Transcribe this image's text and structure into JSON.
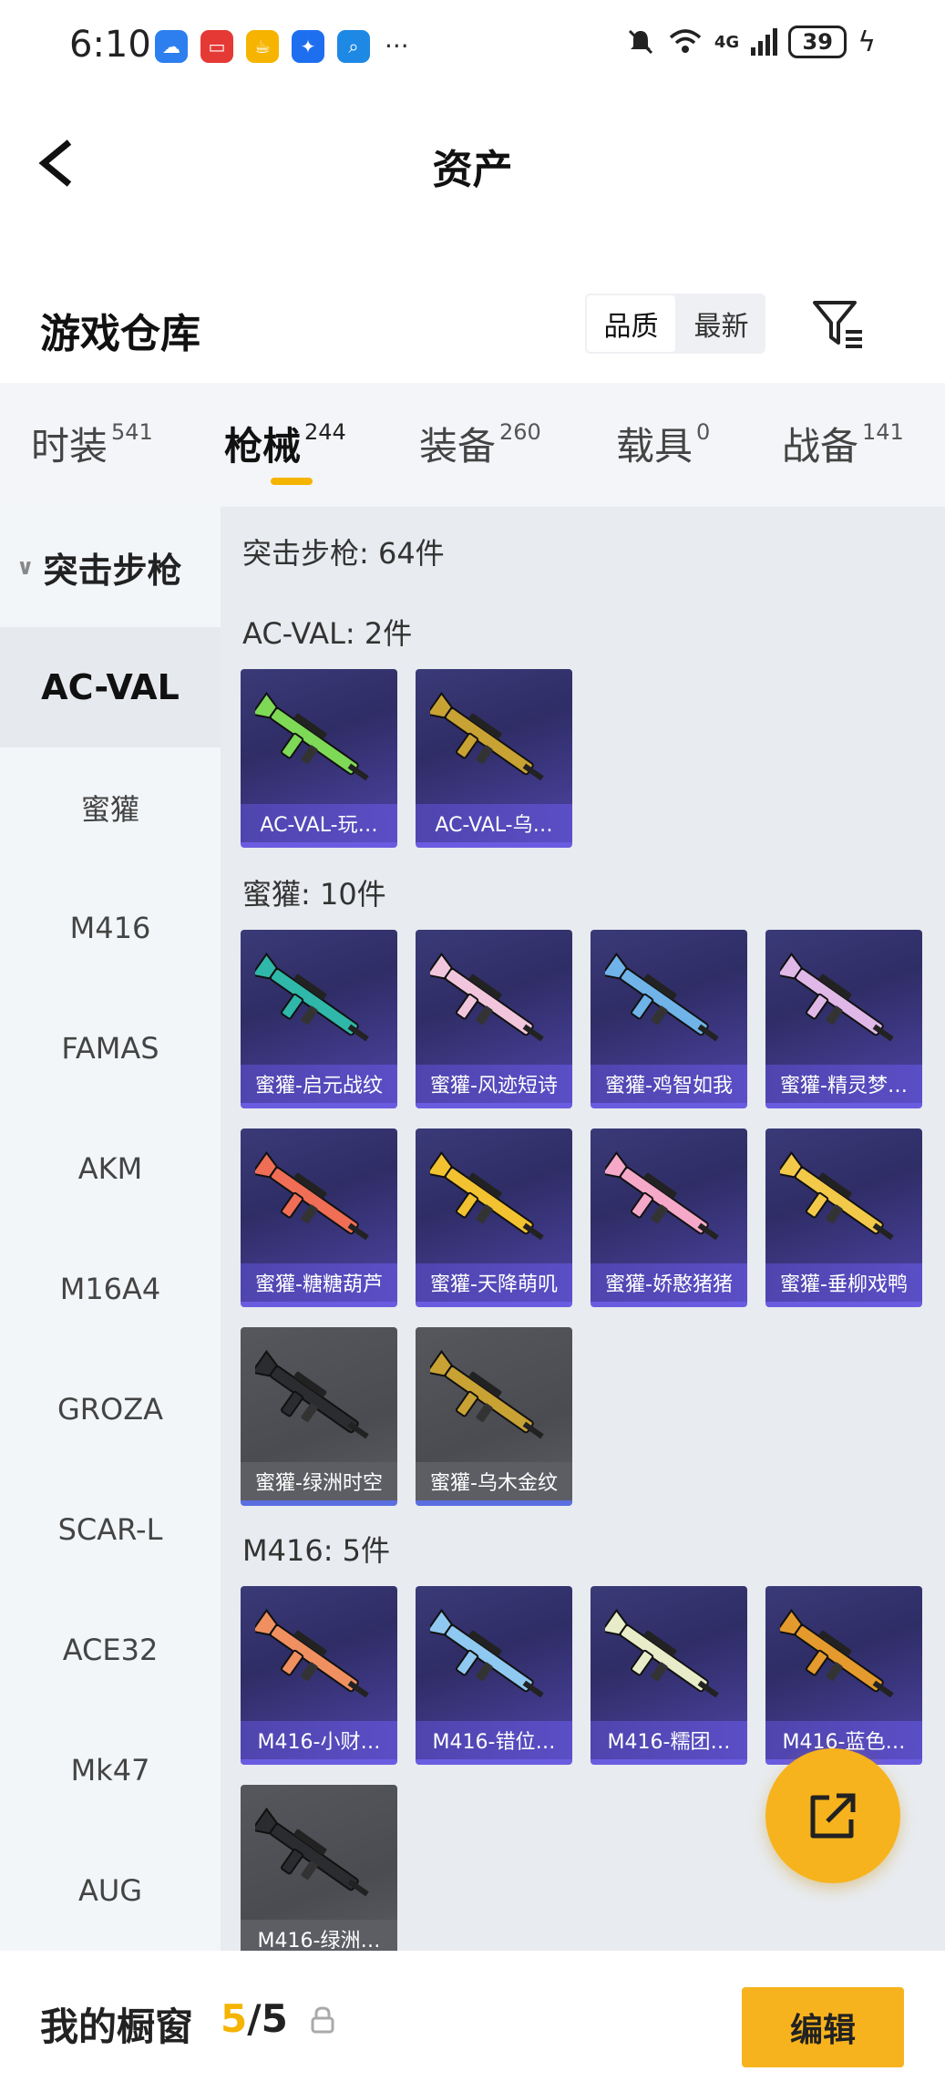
{
  "status_bar": {
    "time": "6:10",
    "battery": "39",
    "network": "4G"
  },
  "header": {
    "title": "资产"
  },
  "warehouse": {
    "title": "游戏仓库",
    "sort_quality": "品质",
    "sort_newest": "最新"
  },
  "tabs": [
    {
      "label": "时装",
      "count": "541"
    },
    {
      "label": "枪械",
      "count": "244"
    },
    {
      "label": "装备",
      "count": "260"
    },
    {
      "label": "载具",
      "count": "0"
    },
    {
      "label": "战备",
      "count": "141"
    }
  ],
  "sidebar": {
    "group": "突击步枪",
    "items": [
      "AC-VAL",
      "蜜獾",
      "M416",
      "FAMAS",
      "AKM",
      "M16A4",
      "GROZA",
      "SCAR-L",
      "ACE32",
      "Mk47",
      "AUG"
    ]
  },
  "content": {
    "summary": "突击步枪: 64件",
    "sections": [
      {
        "label": "AC-VAL: 2件",
        "items": [
          "AC-VAL-玩…",
          "AC-VAL-乌…"
        ]
      },
      {
        "label": "蜜獾: 10件",
        "items": [
          "蜜獾-启元战纹",
          "蜜獾-风迹短诗",
          "蜜獾-鸡智如我",
          "蜜獾-精灵梦…",
          "蜜獾-糖糖葫芦",
          "蜜獾-天降萌叽",
          "蜜獾-娇憨猪猪",
          "蜜獾-垂柳戏鸭",
          "蜜獾-绿洲时空",
          "蜜獾-乌木金纹"
        ]
      },
      {
        "label": "M416: 5件",
        "items": [
          "M416-小财…",
          "M416-错位…",
          "M416-糯团…",
          "M416-蓝色…",
          "M416-绿洲…"
        ]
      }
    ]
  },
  "bottom": {
    "window_label": "我的橱窗",
    "current": "5",
    "total": "/5",
    "edit_label": "编辑"
  },
  "colors": {
    "accent": "#f7b31d",
    "card_purple": "#3a3a78",
    "card_gray": "#55575c"
  }
}
